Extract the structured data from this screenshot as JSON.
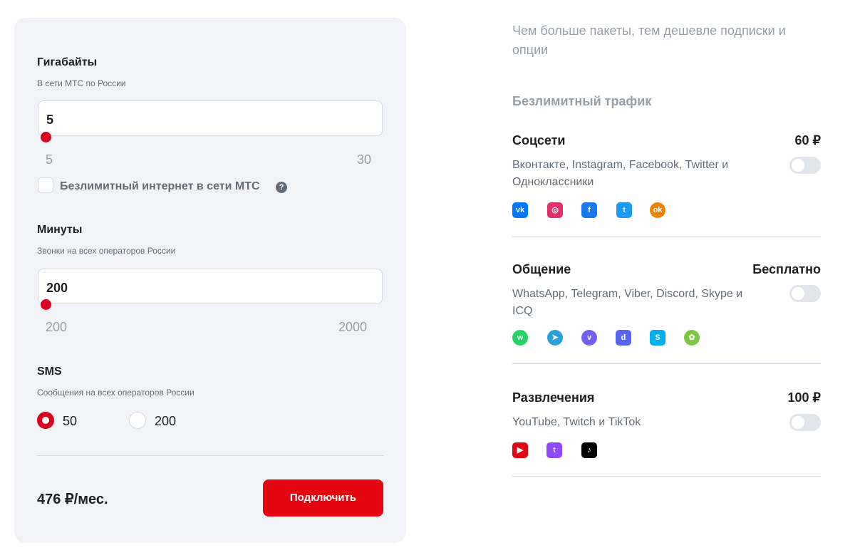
{
  "calculator": {
    "gigabytes": {
      "title": "Гигабайты",
      "subtitle": "В сети МТС по России",
      "value": "5",
      "min": "5",
      "max": "30",
      "level": 0
    },
    "unlimited_checkbox_label": "Безлимитный интернет в сети МТС",
    "minutes": {
      "title": "Минуты",
      "subtitle": "Звонки на всех операторов России",
      "value": "200",
      "min": "200",
      "max": "2000",
      "level": 0
    },
    "sms": {
      "title": "SMS",
      "subtitle": "Сообщения на всех операторов России",
      "options": [
        "50",
        "200"
      ],
      "selected": "50"
    },
    "price": "476 ₽/мес.",
    "connect_label": "Подключить"
  },
  "options_panel": {
    "intro": "Чем больше пакеты, тем дешевле подписки и опции",
    "unlimited_heading": "Безлимитный трафик",
    "groups": [
      {
        "title": "Соцсети",
        "price": "60 ₽",
        "description": "Вконтакте, Instagram, Facebook, Twitter и Одноклассники",
        "enabled": false,
        "icons": [
          "vk-icon",
          "instagram-icon",
          "facebook-icon",
          "twitter-icon",
          "odnoklassniki-icon"
        ]
      },
      {
        "title": "Общение",
        "price": "Бесплатно",
        "description": "WhatsApp, Telegram, Viber, Discord, Skype и ICQ",
        "enabled": false,
        "icons": [
          "whatsapp-icon",
          "telegram-icon",
          "viber-icon",
          "discord-icon",
          "skype-icon",
          "icq-icon"
        ]
      },
      {
        "title": "Развлечения",
        "price": "100 ₽",
        "description": "YouTube, Twitch и TikTok",
        "enabled": false,
        "icons": [
          "youtube-icon",
          "twitch-icon",
          "tiktok-icon"
        ]
      }
    ]
  },
  "colors": {
    "accent": "#e30611",
    "slider_knob": "#d8001e",
    "card_bg": "#f2f3f7"
  }
}
